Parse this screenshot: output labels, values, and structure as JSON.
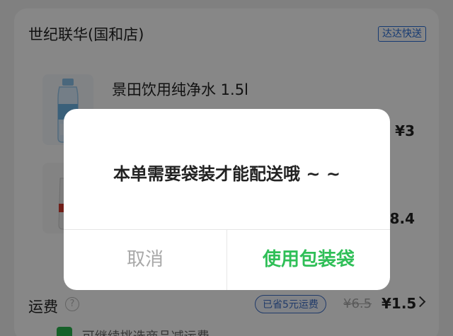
{
  "store": {
    "name": "世纪联华(国和店)",
    "delivery_tag": "达达快送"
  },
  "products": [
    {
      "name": "景田饮用纯净水 1.5l",
      "price": "¥3"
    },
    {
      "name": "",
      "price": "¥8.4"
    }
  ],
  "shipping": {
    "label": "运费",
    "help_icon": "?",
    "saved_badge": "已省5元运费",
    "old_fee": "¥6.5",
    "new_fee": "¥1.5"
  },
  "bottom_hint": "可继续挑选商品减运费",
  "dialog": {
    "message": "本单需要袋装才能配送哦 ~ ~",
    "cancel_label": "取消",
    "confirm_label": "使用包装袋"
  },
  "colors": {
    "accent_green": "#2fbf57",
    "accent_blue": "#2b6fd8",
    "overlay": "rgba(0,0,0,0.47)"
  }
}
